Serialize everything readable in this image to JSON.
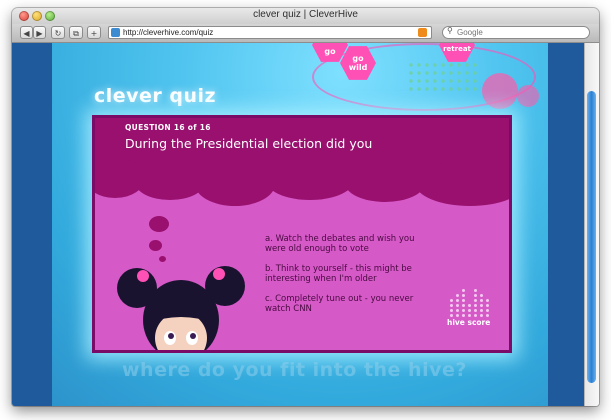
{
  "window": {
    "title": "clever quiz | CleverHive"
  },
  "toolbar": {
    "back_glyph": "◀",
    "forward_glyph": "▶",
    "reload_glyph": "↻",
    "bookmark_glyph": "⧉",
    "add_glyph": "+",
    "url": "http://cleverhive.com/quiz",
    "search_placeholder": "Google"
  },
  "site": {
    "brand": "clever quiz",
    "nav_top": "go wild",
    "nav_top_partial": "go",
    "nav_right_partial": "retreat",
    "tagline": "where do you fit into the hive?"
  },
  "quiz": {
    "question_counter": "QUESTION 16 of 16",
    "question": "During the Presidential election did you",
    "answers": [
      {
        "line1": "a. Watch the debates and wish you",
        "line2": "were old enough to vote"
      },
      {
        "line1": "b. Think to yourself - this might be",
        "line2": "interesting when I'm older"
      },
      {
        "line1": "c. Completely tune out - you never",
        "line2": "watch CNN"
      }
    ],
    "hive_score_label": "hive score"
  },
  "colors": {
    "card_bg": "#d559c7",
    "card_header": "#99106f",
    "page_blue": "#4fc4ef",
    "sidebar_blue": "#1e5a9c",
    "accent_pink": "#ff50b6"
  }
}
